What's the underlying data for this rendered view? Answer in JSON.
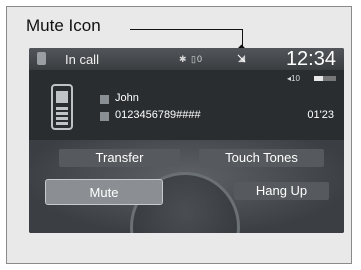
{
  "callout": {
    "label": "Mute Icon"
  },
  "status_bar": {
    "title": "In call",
    "icons_text": "✱ ▯0",
    "clock": "12:34",
    "signal_text": "◂10"
  },
  "contact": {
    "name": "John",
    "number": "0123456789####",
    "call_time": "01'23"
  },
  "menu": {
    "transfer": "Transfer",
    "touch_tones": "Touch Tones",
    "mute": "Mute",
    "hang_up": "Hang Up"
  },
  "colors": {
    "screen_bg": "#2a2d30",
    "selected_button": "#8b8f93"
  },
  "icons": [
    "mute-icon",
    "phone-icon",
    "battery-icon",
    "bluetooth-icon"
  ]
}
